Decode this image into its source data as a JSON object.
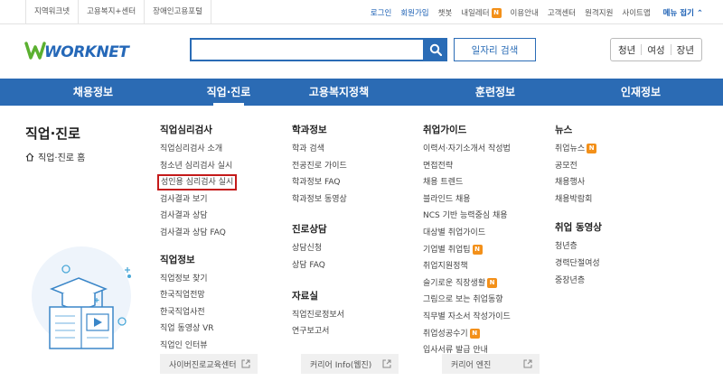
{
  "topbar": {
    "sites": [
      "지역워크넷",
      "고용복지+센터",
      "장애인고용포털"
    ],
    "login": "로그인",
    "join": "회원가입",
    "chatbot": "챗봇",
    "myletter": "내일레터",
    "new_badge": "N",
    "guide": "이용안내",
    "customer": "고객센터",
    "remote": "원격지원",
    "sitemap": "사이트맵",
    "menu_close": "메뉴 접기 ⌃"
  },
  "header": {
    "logo_text": "WORKNET",
    "search_placeholder": "",
    "job_search_label": "일자리 검색",
    "targets": [
      "청년",
      "여성",
      "장년"
    ]
  },
  "gnb": [
    {
      "label": "채용정보",
      "active": false
    },
    {
      "label": "직업·진로",
      "active": true
    },
    {
      "label": "고용복지정책",
      "active": false
    },
    {
      "label": "훈련정보",
      "active": false
    },
    {
      "label": "인재정보",
      "active": false
    }
  ],
  "section": {
    "title": "직업·진로",
    "home": "직업·진로 홈"
  },
  "col1": {
    "g1_title": "직업심리검사",
    "g1_items": [
      "직업심리검사 소개",
      "청소년 심리검사 실시",
      "성인용 심리검사 실시",
      "검사결과 보기",
      "검사결과 상담",
      "검사결과 상담 FAQ"
    ],
    "g2_title": "직업정보",
    "g2_items": [
      "직업정보 찾기",
      "한국직업전망",
      "한국직업사전",
      "직업 동영상 VR",
      "직업인 인터뷰"
    ]
  },
  "col2": {
    "g1_title": "학과정보",
    "g1_items": [
      "학과 검색",
      "전공진로 가이드",
      "학과정보 FAQ",
      "학과정보 동영상"
    ],
    "g2_title": "진로상담",
    "g2_items": [
      "상담신청",
      "상담 FAQ"
    ],
    "g3_title": "자료실",
    "g3_items": [
      "직업진로정보서",
      "연구보고서"
    ]
  },
  "col3": {
    "g1_title": "취업가이드",
    "g1_items": [
      "이력서·자기소개서 작성법",
      "면접전략",
      "채용 트렌드",
      "블라인드 채용",
      "NCS 기반 능력중심 채용",
      "대상별 취업가이드",
      "기업별 취업팁",
      "취업지원정책",
      "슬기로운 직장생활",
      "그림으로 보는 취업동향",
      "직무별 자소서 작성가이드",
      "취업성공수기",
      "입사서류 발급 안내"
    ]
  },
  "col4": {
    "g1_title": "뉴스",
    "g1_items": [
      "취업뉴스",
      "공모전",
      "채용행사",
      "채용박람회"
    ],
    "g2_title": "취업 동영상",
    "g2_items": [
      "청년층",
      "경력단절여성",
      "중장년층"
    ]
  },
  "bottom_links": [
    "사이버진로교육센터",
    "커리어 Info(웹진)",
    "커리어 엔진"
  ],
  "colors": {
    "brand_blue": "#2b6bb4",
    "highlight_red": "#c41a1a",
    "new_badge": "#f39019"
  }
}
